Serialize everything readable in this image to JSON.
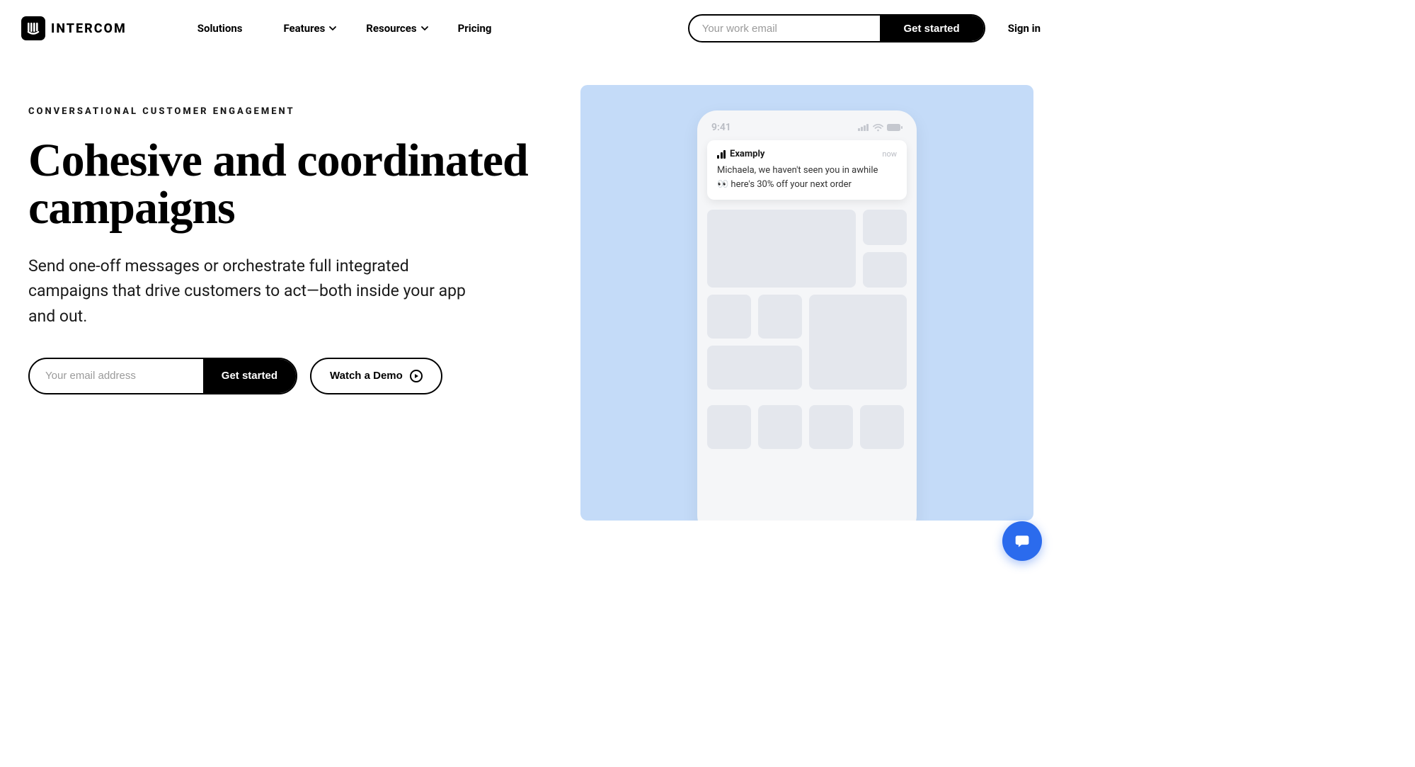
{
  "header": {
    "brand": "INTERCOM",
    "nav": {
      "solutions": "Solutions",
      "features": "Features",
      "resources": "Resources",
      "pricing": "Pricing"
    },
    "email_placeholder": "Your work email",
    "get_started": "Get started",
    "sign_in": "Sign in"
  },
  "hero": {
    "eyebrow": "CONVERSATIONAL CUSTOMER ENGAGEMENT",
    "title": "Cohesive and coordinated campaigns",
    "subtitle": "Send one-off messages or orchestrate full integrated campaigns that drive customers to act—both inside your app and out.",
    "email_placeholder": "Your email address",
    "get_started": "Get started",
    "watch_demo": "Watch a Demo"
  },
  "phone": {
    "time": "9:41",
    "notification": {
      "app": "Examply",
      "timestamp": "now",
      "line1": "Michaela, we haven't seen you in awhile",
      "line2": "👀 here's 30% off your next order"
    }
  }
}
